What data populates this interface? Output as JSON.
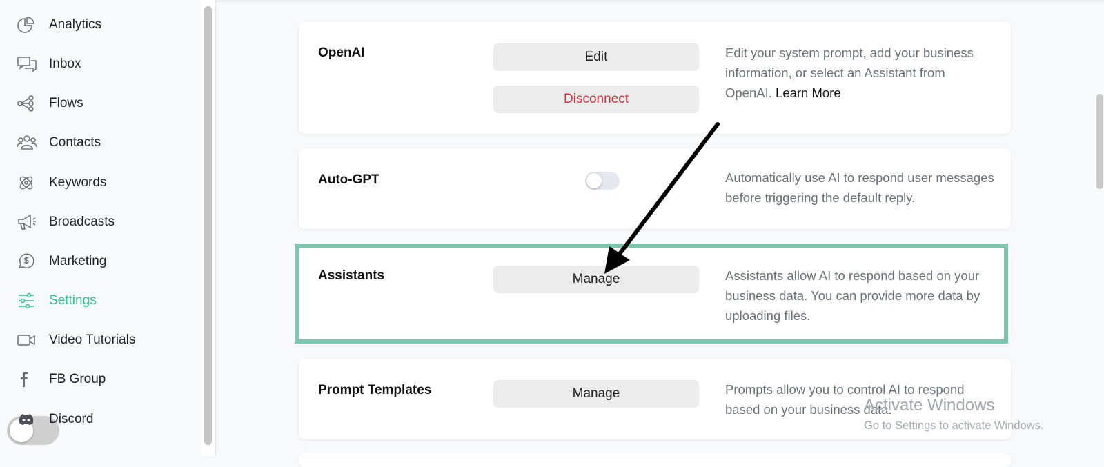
{
  "sidebar": {
    "items": [
      {
        "label": "Analytics",
        "icon": "pie-chart-icon"
      },
      {
        "label": "Inbox",
        "icon": "chat-bubbles-icon"
      },
      {
        "label": "Flows",
        "icon": "flows-icon"
      },
      {
        "label": "Contacts",
        "icon": "contacts-icon"
      },
      {
        "label": "Keywords",
        "icon": "keywords-icon"
      },
      {
        "label": "Broadcasts",
        "icon": "megaphone-icon"
      },
      {
        "label": "Marketing",
        "icon": "dollar-chat-icon"
      },
      {
        "label": "Settings",
        "icon": "sliders-icon",
        "active": true
      },
      {
        "label": "Video Tutorials",
        "icon": "video-camera-icon"
      },
      {
        "label": "FB Group",
        "icon": "facebook-icon"
      },
      {
        "label": "Discord",
        "icon": "discord-icon"
      }
    ]
  },
  "cards": {
    "openai": {
      "title": "OpenAI",
      "edit_label": "Edit",
      "disconnect_label": "Disconnect",
      "description": "Edit your system prompt, add your business information, or select an Assistant from OpenAI.",
      "learn_more": "Learn More"
    },
    "autogpt": {
      "title": "Auto-GPT",
      "toggle_on": false,
      "description": "Automatically use AI to respond user messages before triggering the default reply."
    },
    "assistants": {
      "title": "Assistants",
      "manage_label": "Manage",
      "description": "Assistants allow AI to respond based on your business data. You can provide more data by uploading files."
    },
    "prompt_templates": {
      "title": "Prompt Templates",
      "manage_label": "Manage",
      "description": "Prompts allow you to control AI to respond based on your business data."
    }
  },
  "watermark": {
    "line1": "Activate Windows",
    "line2": "Go to Settings to activate Windows."
  },
  "colors": {
    "accent": "#2fc08d",
    "highlight": "#7fc5ad",
    "danger": "#d92f3a"
  }
}
